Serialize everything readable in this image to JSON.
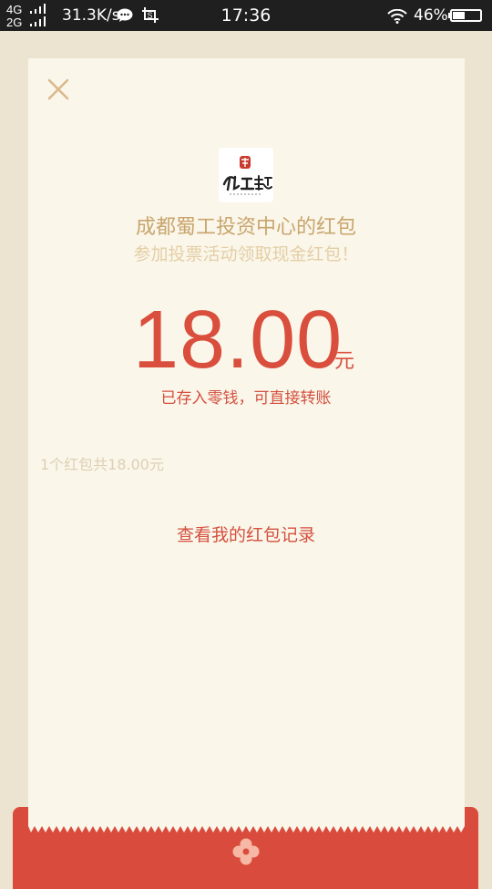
{
  "status_bar": {
    "network_top": "4G",
    "network_bottom": "2G",
    "speed": "31.3K/s",
    "time": "17:36",
    "battery_percent": "46%"
  },
  "card": {
    "sender_title": "成都蜀工投资中心的红包",
    "message": "参加投票活动领取现金红包！",
    "amount": "18.00",
    "currency_unit": "元",
    "stored_note": "已存入零钱，可直接转账",
    "summary": "1个红包共18.00元",
    "view_records_link": "查看我的红包记录"
  },
  "colors": {
    "accent_red": "#d94e3c",
    "gold": "#c9a56d",
    "card_bg": "#faf6ea",
    "page_bg": "#ece3d1"
  },
  "icons": {
    "close": "close-icon",
    "logo": "sender-logo",
    "wifi": "wifi-icon",
    "battery": "battery-icon"
  }
}
